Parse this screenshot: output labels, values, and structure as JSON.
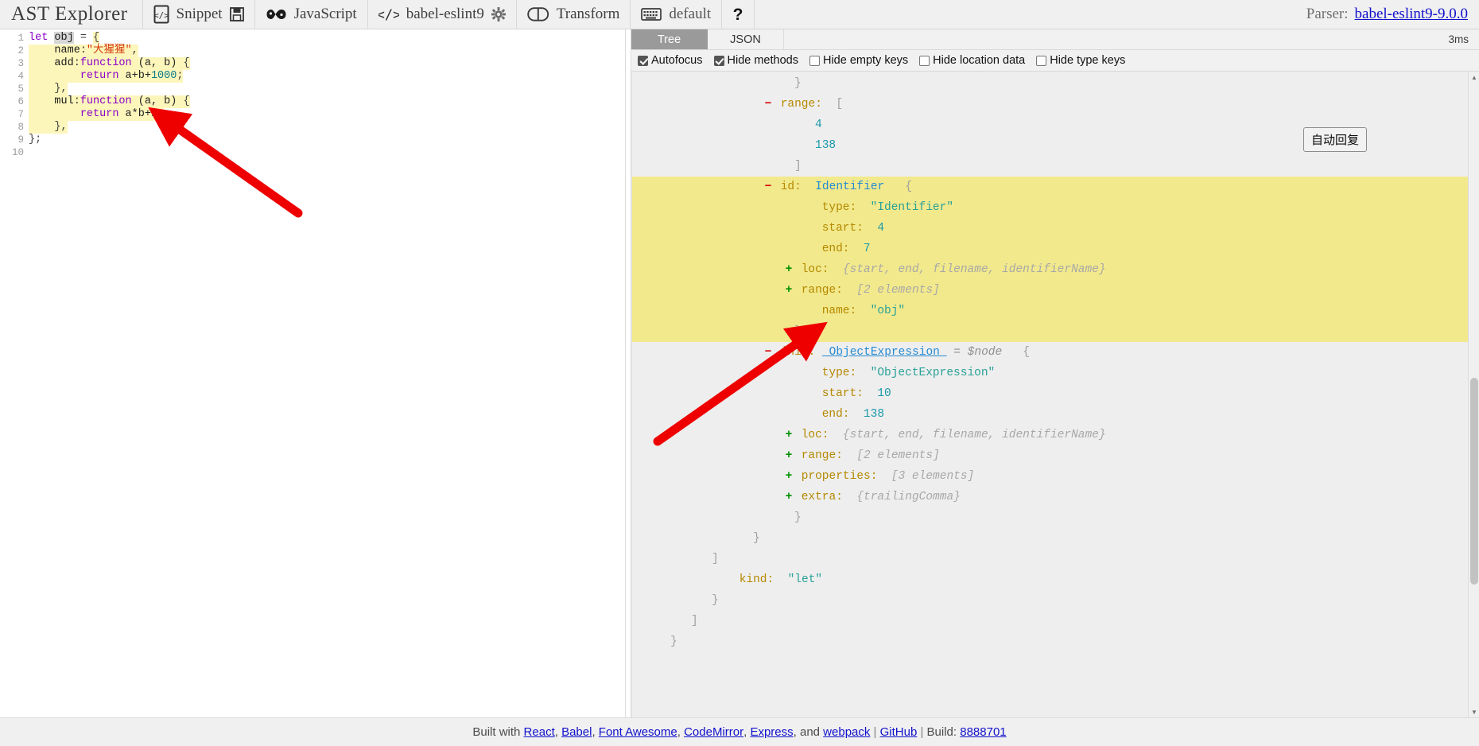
{
  "toolbar": {
    "app_title": "AST Explorer",
    "snippet_label": "Snippet",
    "snippet_icon": "file-code-icon",
    "save_icon": "floppy-disk-icon",
    "language_icon": "infinity-icon",
    "language_label": "JavaScript",
    "parser_icon": "code-brackets-icon",
    "parser_label": "babel-eslint9",
    "settings_icon": "gear-icon",
    "transform_icon": "toggle-icon",
    "transform_label": "Transform",
    "keymap_icon": "keyboard-icon",
    "keymap_label": "default",
    "help_icon": "question-mark-icon",
    "parser_prefix": "Parser:",
    "parser_version": "babel-eslint9-9.0.0"
  },
  "editor": {
    "lines": [
      {
        "n": "1",
        "highlight": false
      },
      {
        "n": "2",
        "highlight": true
      },
      {
        "n": "3",
        "highlight": true
      },
      {
        "n": "4",
        "highlight": true
      },
      {
        "n": "5",
        "highlight": true
      },
      {
        "n": "6",
        "highlight": true
      },
      {
        "n": "7",
        "highlight": true
      },
      {
        "n": "8",
        "highlight": true
      },
      {
        "n": "9",
        "highlight": false
      },
      {
        "n": "10",
        "highlight": false
      }
    ],
    "code_text": [
      "let obj = {",
      "    name:\"大猩猩\",",
      "    add:function (a, b) {",
      "        return a+b+1000;",
      "    },",
      "    mul:function (a, b) {",
      "        return a*b+2;",
      "    },",
      "};",
      ""
    ],
    "l1": {
      "kw": "let",
      "var": "obj",
      "eq": " = ",
      "brace": "{"
    },
    "l2": {
      "indent": "    ",
      "prop": "name",
      "colon": ":",
      "str": "\"大猩猩\"",
      "comma": ","
    },
    "l3": {
      "indent": "    ",
      "prop": "add",
      "colon": ":",
      "kw": "function",
      "params": " (a, b) ",
      "brace": "{"
    },
    "l4": {
      "indent": "        ",
      "kw": "return",
      "expr_a": " a+b+",
      "num": "1000",
      "semi": ";"
    },
    "l5": {
      "indent": "    ",
      "close": "},",
      "_c": ""
    },
    "l6": {
      "indent": "    ",
      "prop": "mul",
      "colon": ":",
      "kw": "function",
      "params": " (a, b) ",
      "brace": "{"
    },
    "l7": {
      "indent": "        ",
      "kw": "return",
      "expr_a": " a*b+",
      "num": "2",
      "semi": ";"
    },
    "l8": {
      "indent": "    ",
      "close": "},",
      "_c": ""
    },
    "l9": {
      "close": "};"
    },
    "l10": {
      "close": ""
    }
  },
  "right_pane": {
    "tabs": [
      {
        "label": "Tree",
        "active": true
      },
      {
        "label": "JSON",
        "active": false
      }
    ],
    "timing": "3ms",
    "options": [
      {
        "label": "Autofocus",
        "checked": true
      },
      {
        "label": "Hide methods",
        "checked": true
      },
      {
        "label": "Hide empty keys",
        "checked": false
      },
      {
        "label": "Hide location data",
        "checked": false
      },
      {
        "label": "Hide type keys",
        "checked": false
      }
    ]
  },
  "ast": {
    "rows": [
      {
        "indent": 7,
        "exp": "none",
        "key": "",
        "punct": "}",
        "kind": "close",
        "hl": false
      },
      {
        "indent": 6,
        "exp": "minus",
        "key": "range:",
        "punct": "[",
        "kind": "open",
        "hl": false
      },
      {
        "indent": 8,
        "exp": "none",
        "key": "",
        "value": "4",
        "kind": "num",
        "hl": false
      },
      {
        "indent": 8,
        "exp": "none",
        "key": "",
        "value": "138",
        "kind": "num",
        "hl": false
      },
      {
        "indent": 7,
        "exp": "none",
        "key": "",
        "punct": "]",
        "kind": "close",
        "hl": false
      },
      {
        "indent": 6,
        "exp": "minus",
        "key": "id:",
        "type": "Identifier",
        "punct": "{",
        "kind": "type",
        "hl": true
      },
      {
        "indent": 8,
        "exp": "none",
        "key": "type:",
        "value": "\"Identifier\"",
        "kind": "str",
        "hl": true
      },
      {
        "indent": 8,
        "exp": "none",
        "key": "start:",
        "value": "4",
        "kind": "num",
        "hl": true
      },
      {
        "indent": 8,
        "exp": "none",
        "key": "end:",
        "value": "7",
        "kind": "num",
        "hl": true
      },
      {
        "indent": 7,
        "exp": "plus",
        "key": "loc:",
        "value": "{start, end, filename, identifierName}",
        "kind": "ph",
        "hl": true
      },
      {
        "indent": 7,
        "exp": "plus",
        "key": "range:",
        "value": "[2 elements]",
        "kind": "ph",
        "hl": true
      },
      {
        "indent": 8,
        "exp": "none",
        "key": "name:",
        "value": "\"obj\"",
        "kind": "str",
        "hl": true
      },
      {
        "indent": 7,
        "exp": "none",
        "key": "",
        "punct": "}",
        "kind": "close",
        "hl": true
      },
      {
        "indent": 6,
        "exp": "minus",
        "key": "init:",
        "link": "ObjectExpression",
        "node": "= $node",
        "punct": "{",
        "kind": "link",
        "hl": false
      },
      {
        "indent": 8,
        "exp": "none",
        "key": "type:",
        "value": "\"ObjectExpression\"",
        "kind": "str",
        "hl": false
      },
      {
        "indent": 8,
        "exp": "none",
        "key": "start:",
        "value": "10",
        "kind": "num",
        "hl": false
      },
      {
        "indent": 8,
        "exp": "none",
        "key": "end:",
        "value": "138",
        "kind": "num",
        "hl": false
      },
      {
        "indent": 7,
        "exp": "plus",
        "key": "loc:",
        "value": "{start, end, filename, identifierName}",
        "kind": "ph",
        "hl": false
      },
      {
        "indent": 7,
        "exp": "plus",
        "key": "range:",
        "value": "[2 elements]",
        "kind": "ph",
        "hl": false
      },
      {
        "indent": 7,
        "exp": "plus",
        "key": "properties:",
        "value": "[3 elements]",
        "kind": "ph",
        "hl": false
      },
      {
        "indent": 7,
        "exp": "plus",
        "key": "extra:",
        "value": "{trailingComma}",
        "kind": "ph",
        "hl": false
      },
      {
        "indent": 7,
        "exp": "none",
        "key": "",
        "punct": "}",
        "kind": "close",
        "hl": false
      },
      {
        "indent": 5,
        "exp": "none",
        "key": "",
        "punct": "}",
        "kind": "close",
        "hl": false
      },
      {
        "indent": 3,
        "exp": "none",
        "key": "",
        "punct": "]",
        "kind": "close",
        "hl": false
      },
      {
        "indent": 4,
        "exp": "none",
        "key": "kind:",
        "value": "\"let\"",
        "kind": "str",
        "hl": false
      },
      {
        "indent": 3,
        "exp": "none",
        "key": "",
        "punct": "}",
        "kind": "close",
        "hl": false
      },
      {
        "indent": 2,
        "exp": "none",
        "key": "",
        "punct": "]",
        "kind": "close",
        "hl": false
      },
      {
        "indent": 1,
        "exp": "none",
        "key": "",
        "punct": "}",
        "kind": "close",
        "hl": false
      }
    ]
  },
  "floating": {
    "auto_reply_label": "自动回复"
  },
  "footer": {
    "prefix": "Built with ",
    "links": [
      "React",
      "Babel",
      "Font Awesome",
      "CodeMirror",
      "Express"
    ],
    "and_word": ", and ",
    "last_link": "webpack",
    "github": "GitHub",
    "build_prefix": "Build: ",
    "build_number": "8888701",
    "separator": " | "
  },
  "colors": {
    "toolbar_bg": "#f0f0f0",
    "tab_active_bg": "#9a9a9a",
    "tree_bg": "#eeeeee",
    "highlight_yellow": "#f2e98c",
    "editor_highlight": "#fdf6bb",
    "link_blue": "#1111cc",
    "annotation_red": "#ee0000"
  }
}
